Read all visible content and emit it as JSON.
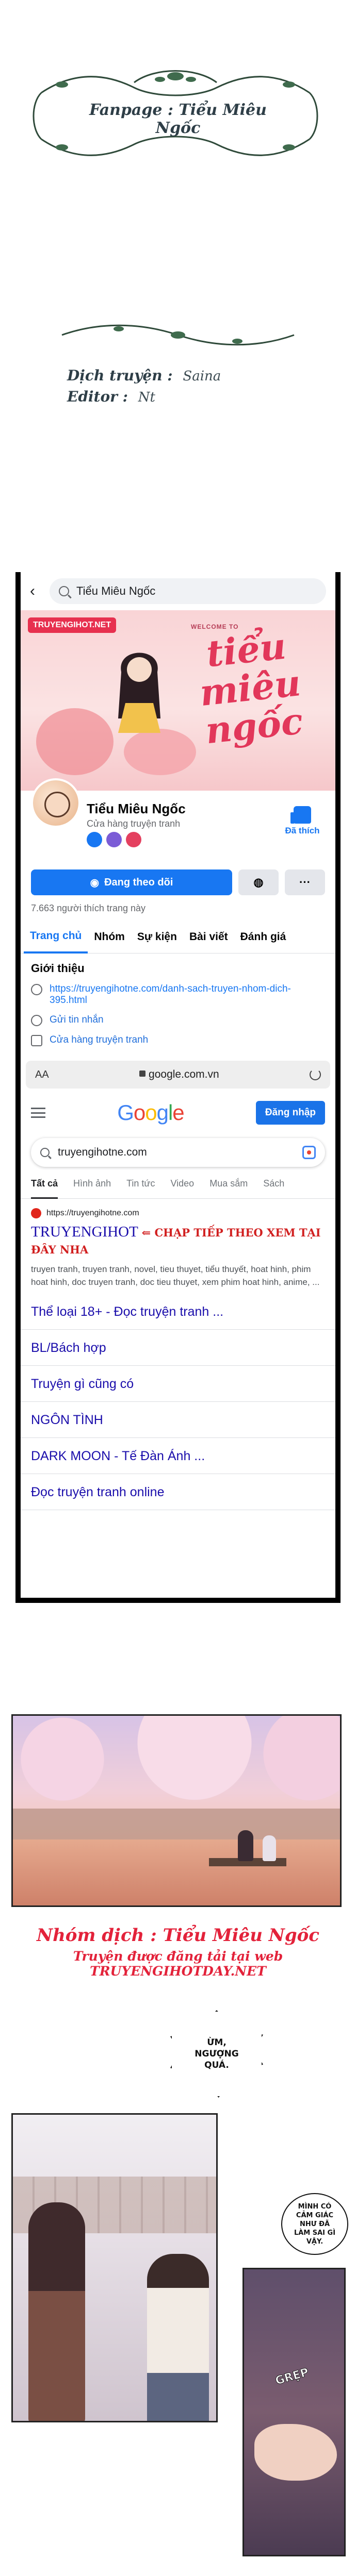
{
  "credit": {
    "fanpage": "Fanpage : Tiểu Miêu Ngốc",
    "lines": [
      {
        "label": "Dịch truyện :",
        "value": "Saina"
      },
      {
        "label": "Editor :",
        "value": "Nt"
      }
    ]
  },
  "facebook": {
    "search_text": "Tiểu Miêu Ngốc",
    "cover_logo": "TRUYENGIHOT.NET",
    "cover_welcome": "WELCOME TO",
    "cover_title": "tiểu miêu ngốc",
    "page_name": "Tiểu Miêu Ngốc",
    "page_category": "Cửa hàng truyện tranh",
    "like_label": "Đã thích",
    "follow_label": "Đang theo dõi",
    "message_icon": "messenger-icon",
    "more_label": "···",
    "like_count": "7.663 người thích trang này",
    "tabs": [
      "Trang chủ",
      "Nhóm",
      "Sự kiện",
      "Bài viết",
      "Đánh giá"
    ],
    "intro_heading": "Giới thiệu",
    "intro_items": [
      {
        "icon": "link-icon",
        "text": "https://truyengihotne.com/danh-sach-truyen-nhom-dich-395.html"
      },
      {
        "icon": "messenger-icon",
        "text": "Gửi tin nhắn"
      },
      {
        "icon": "shop-icon",
        "text": "Cửa hàng truyện tranh"
      }
    ]
  },
  "browser": {
    "aa_label": "AA",
    "url": "google.com.vn"
  },
  "google": {
    "logo": [
      "G",
      "o",
      "o",
      "g",
      "l",
      "e"
    ],
    "signin_label": "Đăng nhập",
    "query": "truyengihotne.com",
    "tabs": [
      "Tất cả",
      "Hình ảnh",
      "Tin tức",
      "Video",
      "Mua sắm",
      "Sách"
    ],
    "result": {
      "url": "https://truyengihotne.com",
      "title": "TRUYENGIHOT",
      "promo": "⇐ CHẠP TIẾP THEO XEM TẠI ĐÂY NHA",
      "snippet": "truyen tranh, truyen tranh, novel, tieu thuyet, tiểu thuyết, hoat hinh, phim hoat hinh, doc truyen tranh, doc tieu thuyet, xem phim hoat hinh, anime, ..."
    },
    "sitelinks": [
      "Thể loại 18+ - Đọc truyện tranh ...",
      "BL/Bách hợp",
      "Truyện gì cũng có",
      "NGÔN TÌNH",
      "DARK MOON - Tế Đàn Ánh ...",
      "Đọc truyện tranh online"
    ]
  },
  "manga": {
    "group_credit": "Nhóm dịch : Tiểu Miêu Ngốc",
    "site_credit": "Truyện được đăng tải tại web TRUYENGIHOTDAY.NET",
    "bubble_1": "ỪM, NGƯỢNG QUÁ.",
    "bubble_2": "MÌNH CÓ CẢM GIÁC NHƯ ĐÃ LÀM SAI GÌ VẬY.",
    "sfx": "GRẸP"
  }
}
